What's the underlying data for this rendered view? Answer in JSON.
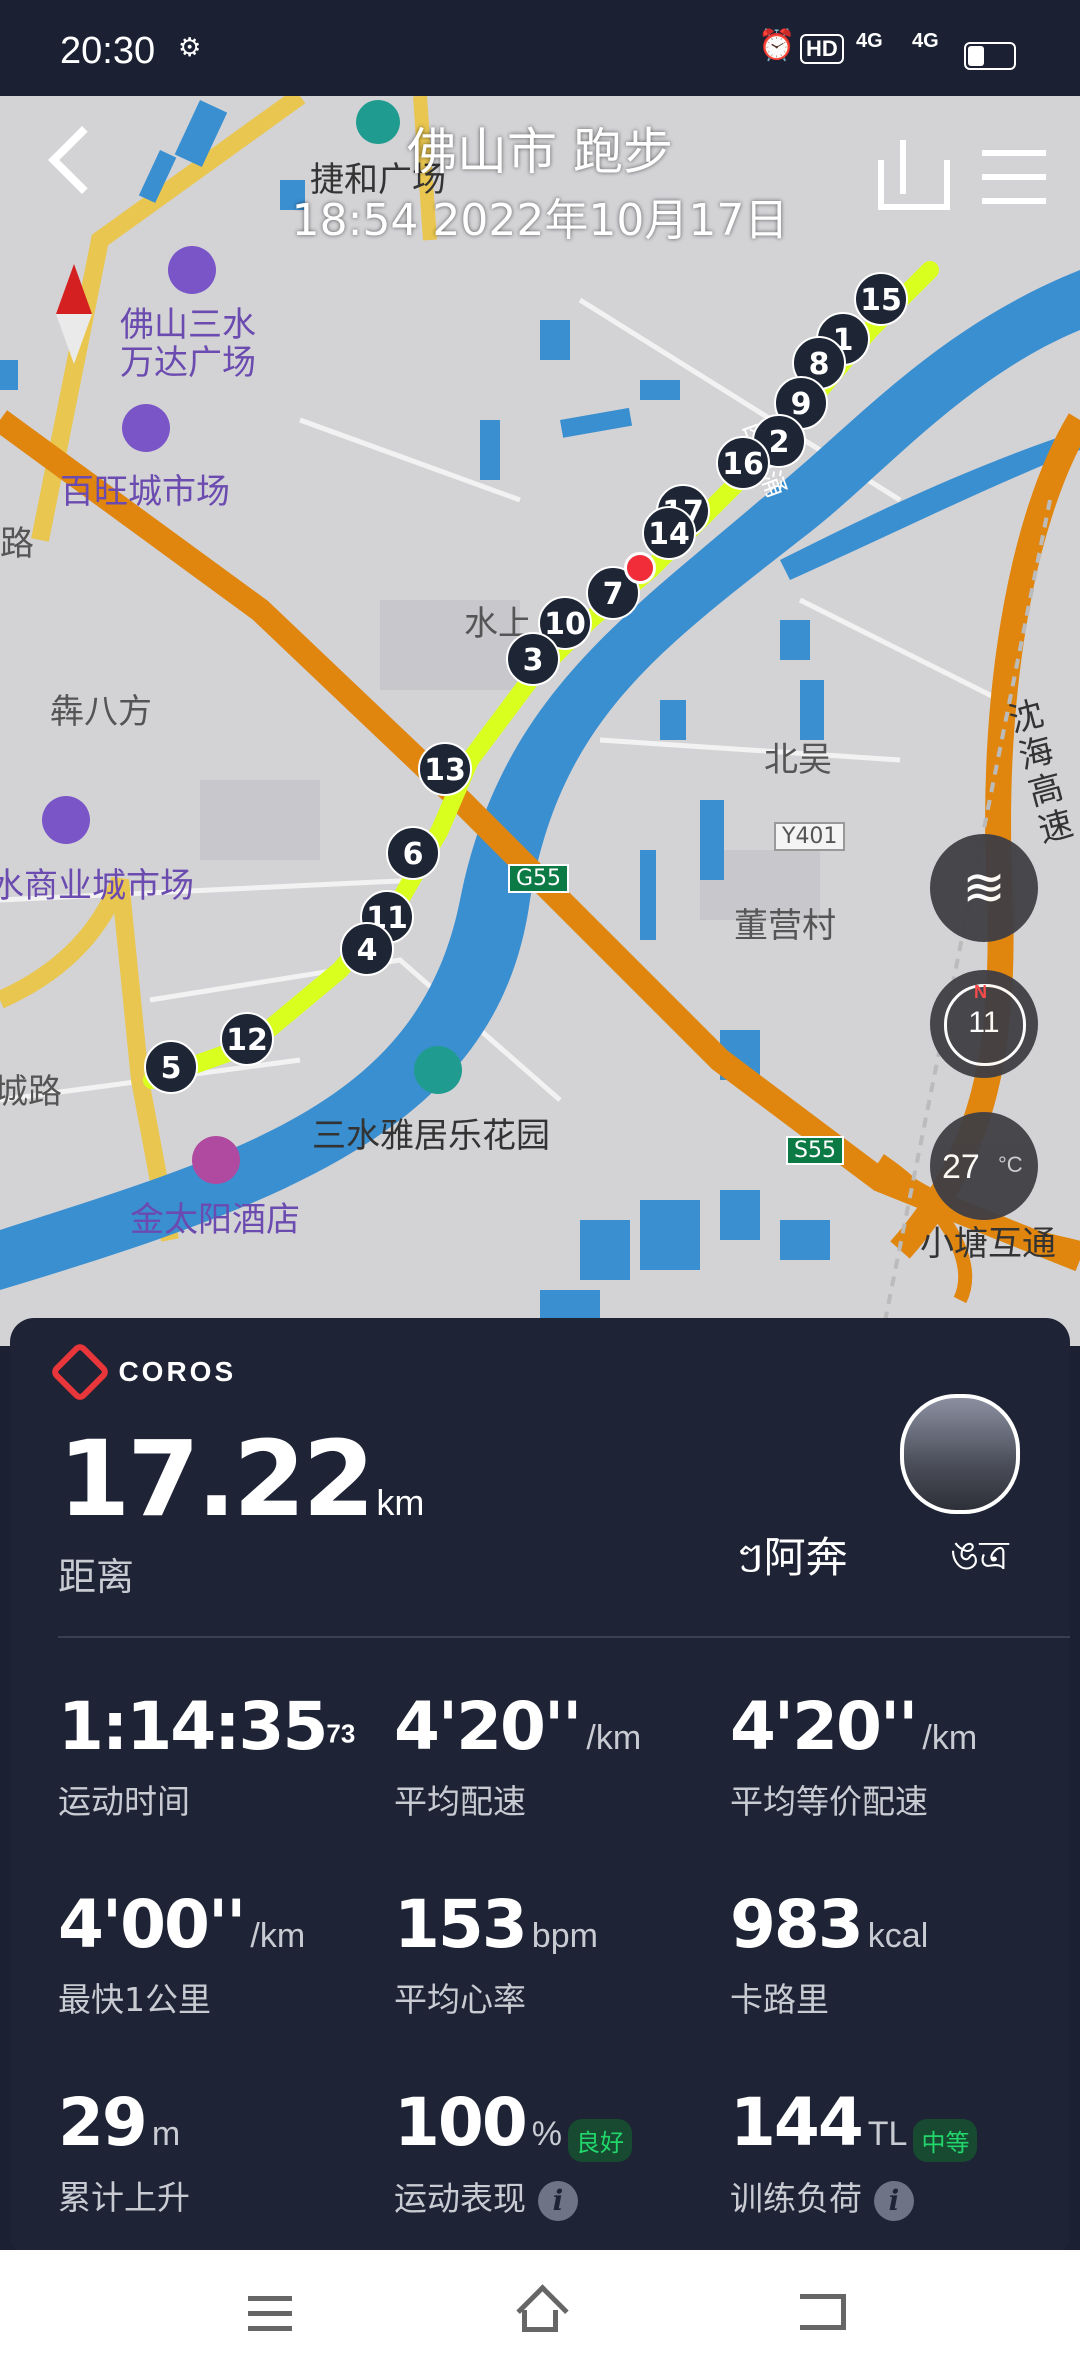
{
  "status_bar": {
    "time": "20:30",
    "icons": [
      "settings-icon",
      "alarm-icon",
      "hd-icon",
      "4g-signal-icon",
      "4g-signal-icon",
      "battery-icon"
    ],
    "hd_label": "HD",
    "sig1": "4G",
    "sig2": "4G"
  },
  "header": {
    "title": "佛山市 跑步",
    "subtitle": "18:54 2022年10月17日"
  },
  "map": {
    "labels": {
      "jiehe": "捷和广场",
      "wanda": "佛山三水\n万达广场",
      "baiwang": "百旺城市场",
      "lu_left": "路",
      "weibafang": "犇八方",
      "shangye": "水商业城市场",
      "chenglu": "城路",
      "jintaiyang": "金太阳酒店",
      "sanshui_yaju": "三水雅居乐花园",
      "shuishang": "水上",
      "beiwu": "北吴",
      "dongying": "董营村",
      "y401": "Y401",
      "g55": "G55",
      "s55": "S55",
      "xinanyong": "西南涌",
      "shenhai": "沈海高速",
      "xiaotang": "小塘互通"
    },
    "km_markers": [
      "15",
      "1",
      "8",
      "9",
      "2",
      "16",
      "17",
      "14",
      "7",
      "10",
      "3",
      "13",
      "6",
      "11",
      "4",
      "12",
      "5"
    ],
    "compass_value": "11",
    "compass_north": "N",
    "temperature": "27",
    "temperature_unit": "°C"
  },
  "panel": {
    "brand": "COROS",
    "distance": "17.22",
    "distance_unit": "km",
    "distance_label": "距离",
    "username": "ៗ阿奔",
    "user_suffix": "ঙত্র",
    "stats": [
      {
        "value": "1:14:35",
        "sup": "73",
        "unit": "",
        "label": "运动时间"
      },
      {
        "value": "4'20''",
        "unit": "/km",
        "label": "平均配速"
      },
      {
        "value": "4'20''",
        "unit": "/km",
        "label": "平均等价配速"
      },
      {
        "value": "4'00''",
        "unit": "/km",
        "label": "最快1公里"
      },
      {
        "value": "153",
        "unit": "bpm",
        "label": "平均心率"
      },
      {
        "value": "983",
        "unit": "kcal",
        "label": "卡路里"
      },
      {
        "value": "29",
        "unit": "m",
        "label": "累计上升"
      },
      {
        "value": "100",
        "unit": "%",
        "label": "运动表现",
        "badge": "良好"
      },
      {
        "value": "144",
        "unit": "TL",
        "label": "训练负荷",
        "badge": "中等"
      }
    ]
  },
  "colors": {
    "route": "#d9ff1e",
    "river": "#3a8fd0",
    "highway": "#e0860f",
    "panel": "#1e2335",
    "accent_green": "#22d66b"
  }
}
